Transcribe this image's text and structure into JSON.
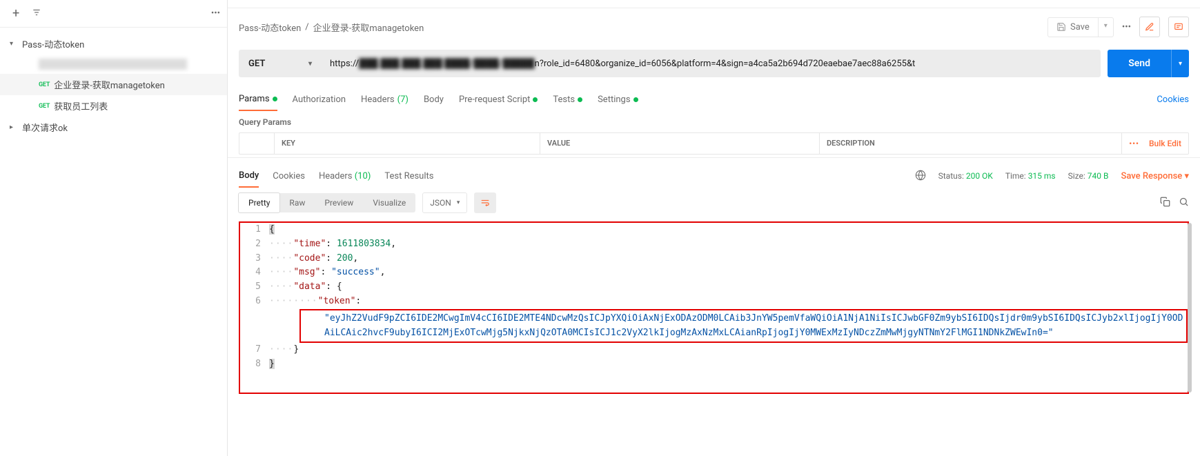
{
  "sidebar": {
    "items": [
      {
        "type": "folder",
        "expanded": true,
        "label": "Pass-动态token",
        "depth": 0,
        "active": false
      },
      {
        "type": "blurred",
        "label": "GET ██████████-██████████",
        "depth": 1,
        "active": false
      },
      {
        "type": "request",
        "method": "GET",
        "label": "企业登录-获取managetoken",
        "depth": 1,
        "active": true
      },
      {
        "type": "request",
        "method": "GET",
        "label": "获取员工列表",
        "depth": 1,
        "active": false
      },
      {
        "type": "folder",
        "expanded": false,
        "label": "单次请求ok",
        "depth": 0,
        "active": false
      }
    ]
  },
  "breadcrumb": {
    "parent": "Pass-动态token",
    "current": "企业登录-获取managetoken"
  },
  "toolbar": {
    "save_label": "Save"
  },
  "request": {
    "method": "GET",
    "url_prefix": "https://",
    "url_blur": "███.███.███.███:████/████/█████",
    "url_suffix": "n?role_id=6480&organize_id=6056&platform=4&sign=a4ca5a2b694d720eaebae7aec88a6255&t",
    "send_label": "Send"
  },
  "req_tabs": {
    "params": "Params",
    "authorization": "Authorization",
    "headers": "Headers",
    "headers_count": "(7)",
    "body": "Body",
    "prerequest": "Pre-request Script",
    "tests": "Tests",
    "settings": "Settings",
    "cookies": "Cookies"
  },
  "query": {
    "header": "Query Params",
    "key": "KEY",
    "value": "VALUE",
    "description": "DESCRIPTION",
    "bulk": "Bulk Edit"
  },
  "resp_tabs": {
    "body": "Body",
    "cookies": "Cookies",
    "headers": "Headers",
    "headers_count": "(10)",
    "tests": "Test Results"
  },
  "resp_meta": {
    "status_label": "Status:",
    "status_value": "200 OK",
    "time_label": "Time:",
    "time_value": "315 ms",
    "size_label": "Size:",
    "size_value": "740 B",
    "save_response": "Save Response"
  },
  "body_toolbar": {
    "pretty": "Pretty",
    "raw": "Raw",
    "preview": "Preview",
    "visualize": "Visualize",
    "format": "JSON"
  },
  "response_body": {
    "time_key": "\"time\"",
    "time_val": "1611803834",
    "code_key": "\"code\"",
    "code_val": "200",
    "msg_key": "\"msg\"",
    "msg_val": "\"success\"",
    "data_key": "\"data\"",
    "token_key": "\"token\"",
    "token_val": "\"eyJhZ2VudF9pZCI6IDE2MCwgImV4cCI6IDE2MTE4NDcwMzQsICJpYXQiOiAxNjExODAzODM0LCAib3JnYW5pemVfaWQiOiA1NjA1NiIsICJwbGF0Zm9ybSI6IDQsIjdr0m9ybSI6IDQsICJyb2xlIjogIjY0ODAiLCAic2hvcF9ubyI6ICI2MjExOTcwMjg5NjkxNjQzOTA0MCIsICJ1c2VyX2lkIjogMzAxNzMxLCAianRpIjogIjY0MWExMzIyNDczZmMwMjgyNTNmY2FlMGI1NDNkZWEwIn0=\""
  }
}
